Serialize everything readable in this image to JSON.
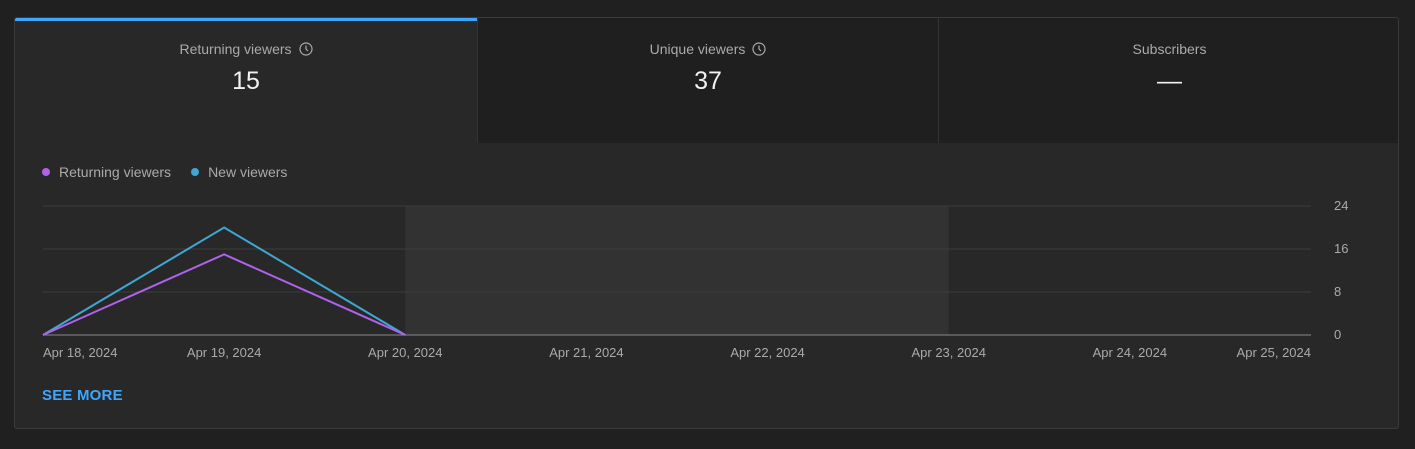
{
  "tabs": [
    {
      "label": "Returning viewers",
      "value": "15",
      "has_info_icon": true,
      "active": true
    },
    {
      "label": "Unique viewers",
      "value": "37",
      "has_info_icon": true,
      "active": false
    },
    {
      "label": "Subscribers",
      "value": "—",
      "has_info_icon": false,
      "active": false
    }
  ],
  "legend": [
    {
      "label": "Returning viewers",
      "color": "#b062ea"
    },
    {
      "label": "New viewers",
      "color": "#3ea8d2"
    }
  ],
  "see_more": "SEE MORE",
  "colors": {
    "accent": "#3ea6ff",
    "background": "#282828",
    "highlight": "#323232"
  },
  "chart_data": {
    "type": "line",
    "x": [
      "Apr 18, 2024",
      "Apr 19, 2024",
      "Apr 20, 2024",
      "Apr 21, 2024",
      "Apr 22, 2024",
      "Apr 23, 2024",
      "Apr 24, 2024",
      "Apr 25, 2024"
    ],
    "series": [
      {
        "name": "Returning viewers",
        "color": "#b062ea",
        "values": [
          0,
          15,
          0,
          null,
          null,
          null,
          null,
          null
        ]
      },
      {
        "name": "New viewers",
        "color": "#3ea8d2",
        "values": [
          0,
          20,
          0,
          null,
          null,
          null,
          null,
          null
        ]
      }
    ],
    "yticks": [
      "0",
      "8",
      "16",
      "24"
    ],
    "ylim": [
      0,
      24
    ],
    "y_axis_position": "right",
    "highlight_range": [
      "Apr 20, 2024",
      "Apr 23, 2024"
    ],
    "grid": true
  }
}
